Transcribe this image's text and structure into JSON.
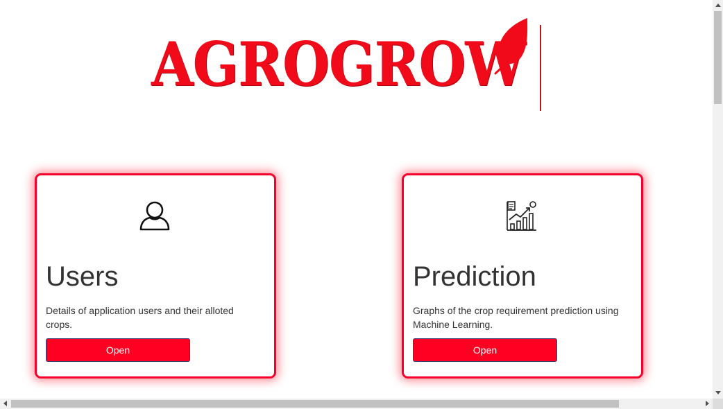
{
  "brand": {
    "name": "AGROGROW",
    "color": "#f00a1a",
    "logo_icon": "leaf-icon"
  },
  "cards": [
    {
      "title": "Users",
      "description": "Details of application users and their alloted crops.",
      "button": "Open",
      "icon": "user-icon"
    },
    {
      "title": "Prediction",
      "description": "Graphs of the crop requirement prediction using Machine Learning.",
      "button": "Open",
      "icon": "growth-chart-icon"
    }
  ],
  "colors": {
    "accent": "#ff0022",
    "card_border": "#f5002a",
    "button_text": "#ffffff",
    "text": "#333333"
  }
}
